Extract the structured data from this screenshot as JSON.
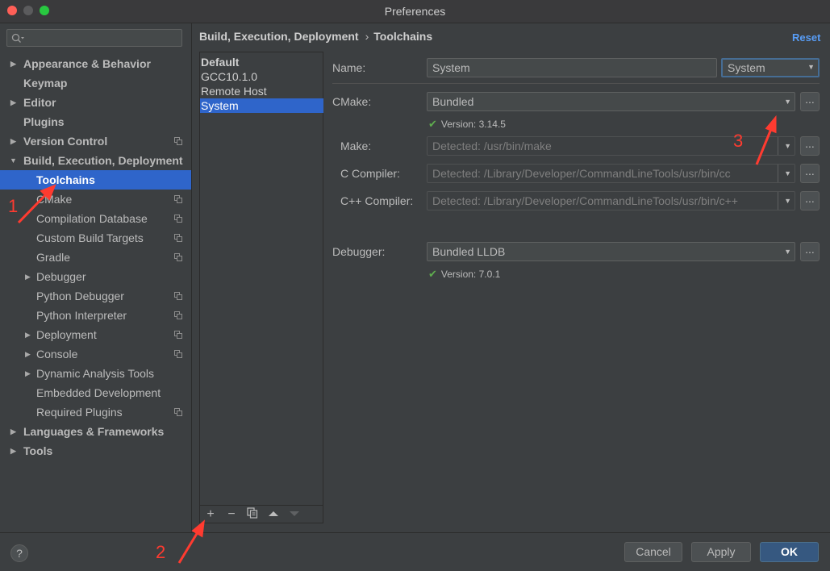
{
  "window": {
    "title": "Preferences"
  },
  "sidebar": {
    "search_placeholder": "",
    "items": [
      {
        "label": "Appearance & Behavior"
      },
      {
        "label": "Keymap"
      },
      {
        "label": "Editor"
      },
      {
        "label": "Plugins"
      },
      {
        "label": "Version Control"
      },
      {
        "label": "Build, Execution, Deployment"
      },
      {
        "label": "Toolchains",
        "selected": true
      },
      {
        "label": "CMake"
      },
      {
        "label": "Compilation Database"
      },
      {
        "label": "Custom Build Targets"
      },
      {
        "label": "Gradle"
      },
      {
        "label": "Debugger"
      },
      {
        "label": "Python Debugger"
      },
      {
        "label": "Python Interpreter"
      },
      {
        "label": "Deployment"
      },
      {
        "label": "Console"
      },
      {
        "label": "Dynamic Analysis Tools"
      },
      {
        "label": "Embedded Development"
      },
      {
        "label": "Required Plugins"
      },
      {
        "label": "Languages & Frameworks"
      },
      {
        "label": "Tools"
      }
    ]
  },
  "breadcrumb": {
    "parent": "Build, Execution, Deployment",
    "separator": "›",
    "current": "Toolchains"
  },
  "reset_label": "Reset",
  "toolchains": {
    "items": [
      "Default",
      "GCC10.1.0",
      "Remote Host",
      "System"
    ],
    "selected": "System"
  },
  "form": {
    "name": {
      "label": "Name:",
      "value": "System",
      "type_value": "System"
    },
    "cmake": {
      "label": "CMake:",
      "value": "Bundled",
      "version": "Version: 3.14.5"
    },
    "make": {
      "label": "Make:",
      "value": "Detected: /usr/bin/make"
    },
    "c_compiler": {
      "label": "C Compiler:",
      "value": "Detected: /Library/Developer/CommandLineTools/usr/bin/cc"
    },
    "cpp_compiler": {
      "label": "C++ Compiler:",
      "value": "Detected: /Library/Developer/CommandLineTools/usr/bin/c++"
    },
    "debugger": {
      "label": "Debugger:",
      "value": "Bundled LLDB",
      "version": "Version: 7.0.1"
    },
    "browse_label": "..."
  },
  "buttons": {
    "help": "?",
    "cancel": "Cancel",
    "apply": "Apply",
    "ok": "OK"
  },
  "annotations": [
    "1",
    "2",
    "3"
  ],
  "colors": {
    "accent": "#2f65ca",
    "link": "#589df6",
    "annotation": "#ff3b30",
    "check": "#5fad4e"
  }
}
